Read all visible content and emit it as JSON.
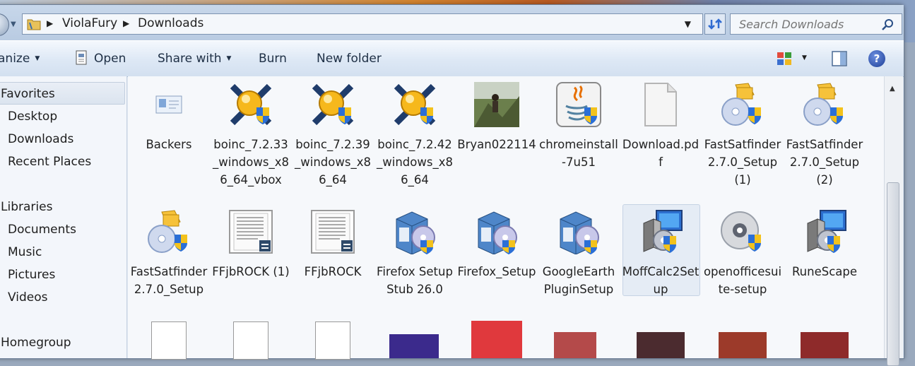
{
  "address": {
    "crumbs": [
      "ViolaFury",
      "Downloads"
    ],
    "search_placeholder": "Search Downloads"
  },
  "toolbar": {
    "organize_label": "anize",
    "open_label": "Open",
    "share_label": "Share with",
    "burn_label": "Burn",
    "new_folder_label": "New folder",
    "help_glyph": "?"
  },
  "sidebar": {
    "favorites": "Favorites",
    "desktop": "Desktop",
    "downloads": "Downloads",
    "recent": "Recent Places",
    "libraries": "Libraries",
    "documents": "Documents",
    "music": "Music",
    "pictures": "Pictures",
    "videos": "Videos",
    "homegroup": "Homegroup"
  },
  "files": {
    "row1": [
      {
        "label": "Backers",
        "icon": "contact-card-icon"
      },
      {
        "label": "boinc_7.2.33_windows_x86_64_vbox",
        "icon": "boinc-installer-icon"
      },
      {
        "label": "boinc_7.2.39_windows_x86_64",
        "icon": "boinc-installer-icon"
      },
      {
        "label": "boinc_7.2.42_windows_x86_64",
        "icon": "boinc-installer-icon"
      },
      {
        "label": "Bryan022114",
        "icon": "photo-thumbnail-icon"
      },
      {
        "label": "chromeinstall-7u51",
        "icon": "java-installer-icon"
      },
      {
        "label": "Download.pdf",
        "icon": "blank-document-icon"
      },
      {
        "label": "FastSatfinder2.7.0_Setup (1)",
        "icon": "setup-disc-icon"
      },
      {
        "label": "FastSatfinder2.7.0_Setup (2)",
        "icon": "setup-disc-icon"
      }
    ],
    "row2": [
      {
        "label": "FastSatfinder2.7.0_Setup",
        "icon": "setup-disc-icon"
      },
      {
        "label": "FFjbROCK (1)",
        "icon": "text-document-icon"
      },
      {
        "label": "FFjbROCK",
        "icon": "text-document-icon"
      },
      {
        "label": "Firefox Setup Stub 26.0",
        "icon": "installer-box-icon"
      },
      {
        "label": "Firefox_Setup",
        "icon": "installer-box-icon"
      },
      {
        "label": "GoogleEarthPluginSetup",
        "icon": "installer-box-icon"
      },
      {
        "label": "MoffCalc2Setup",
        "icon": "computer-installer-icon"
      },
      {
        "label": "openofficesuite-setup",
        "icon": "cd-shield-icon"
      },
      {
        "label": "RuneScape",
        "icon": "computer-installer-icon"
      }
    ]
  },
  "colors": {
    "accent": "#1d3f96",
    "shield_blue": "#2b6fd6",
    "shield_yellow": "#f3c21c"
  }
}
